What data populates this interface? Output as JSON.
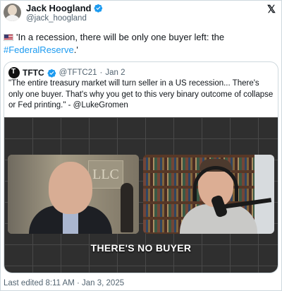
{
  "author": {
    "name": "Jack Hoogland",
    "handle": "@jack_hoogland"
  },
  "post": {
    "text_before": "'In a recession, there will be only one buyer left: the ",
    "hashtag": "#FederalReserve",
    "text_after": ".'"
  },
  "quoted": {
    "name": "TFTC",
    "handle": "@TFTC21",
    "separator": "·",
    "date": "Jan 2",
    "text": "\"The entire treasury market will turn seller in a US recession... There's only one buyer. That's why you get to this very binary outcome of collapse or Fed printing.\" - @LukeGromen",
    "video_caption": "THERE'S NO BUYER",
    "sign_text": "LLC"
  },
  "footer": {
    "edited": "Last edited 8:11 AM · Jan 3, 2025"
  },
  "icons": [
    "avatar",
    "verified-badge-icon",
    "x-logo-icon",
    "us-flag-icon",
    "tftc-avatar"
  ],
  "colors": {
    "link": "#1d9bf0",
    "secondary_text": "#536471",
    "border": "#cfd9de"
  }
}
